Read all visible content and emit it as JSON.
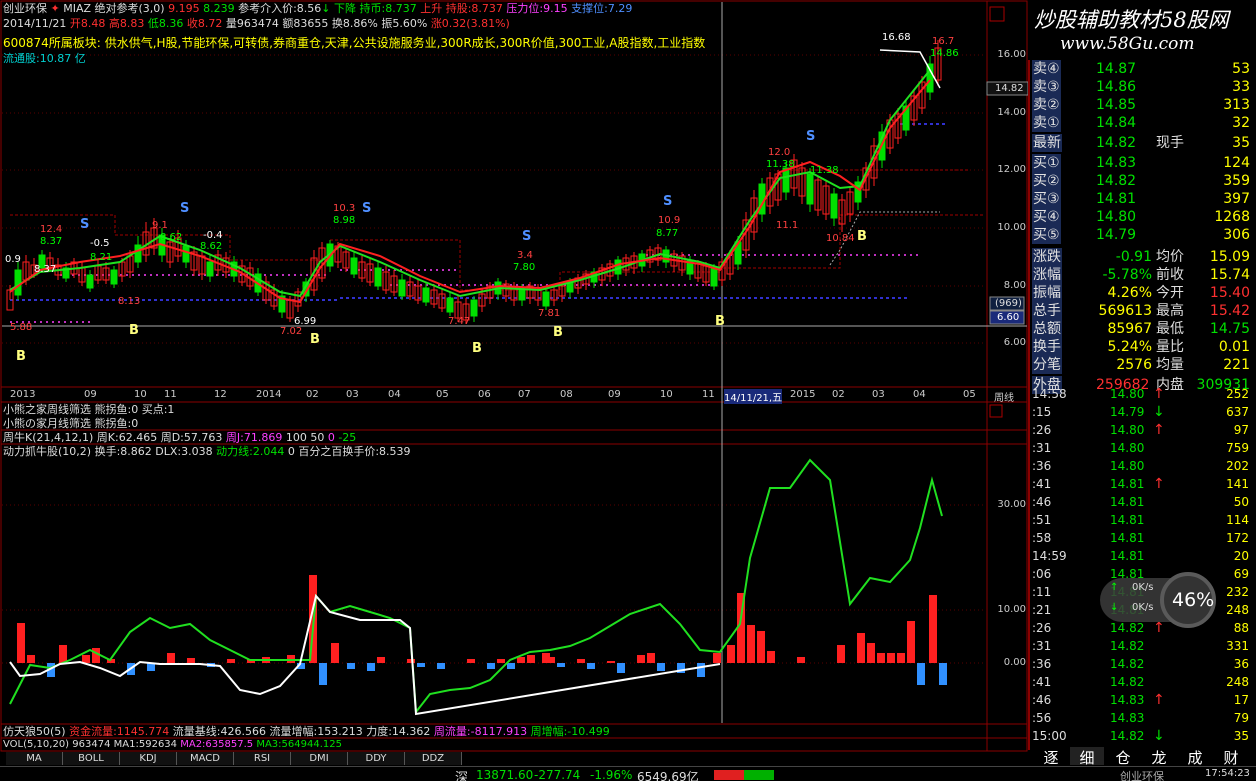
{
  "watermark": {
    "text": "炒股辅助教材58股网",
    "url": "www.58Gu.com"
  },
  "header": {
    "stock": "创业环保",
    "mode": "MIAZ",
    "ref": "绝对参考(3,0)",
    "ref_v1": "9.195",
    "ref_v2": "8.239",
    "ref_in": "参考介入价:8.56",
    "down": "下降",
    "hold": "持币:8.737",
    "up": "上升",
    "hold2": "持股:8.737",
    "press": "压力位:9.15",
    "support": "支撑位:7.29",
    "date": "2014/11/21",
    "open": "开8.48",
    "high": "高8.83",
    "low": "低8.36",
    "close": "收8.72",
    "vol": "量963474",
    "amt": "额83655",
    "turn": "换8.86%",
    "amp": "振5.60%",
    "chg": "涨0.32(3.81%)",
    "sector_label": "600874所属板块:",
    "sectors": "供水供气,H股,节能环保,可转债,券商重仓,天津,公共设施服务业,300R成长,300R价值,300工业,A股指数,工业指数",
    "float": "流通股:10.87 亿"
  },
  "price_axis": [
    "16.00",
    "14.00",
    "12.00",
    "10.00",
    "8.00",
    "6.00"
  ],
  "price_tags": {
    "last": "14.82",
    "crosshair_top": "(969)",
    "crosshair_val": "6.60"
  },
  "time_axis": [
    "2013",
    "09",
    "10",
    "11",
    "12",
    "2014",
    "02",
    "03",
    "04",
    "05",
    "06",
    "07",
    "08",
    "09",
    "10",
    "11",
    "14/11/21,五",
    "2015",
    "02",
    "03",
    "04",
    "05",
    "周线"
  ],
  "annotations": [
    "16.68",
    "16.7",
    "14.86",
    "12.4",
    "8.37",
    "-0.5",
    "8.21",
    "9.1",
    "8.62",
    "-0.4",
    "8.62",
    "10.3",
    "8.98",
    "3.4",
    "7.80",
    "10.9",
    "8.77",
    "12.0",
    "11.38",
    "11.1",
    "11.38",
    "10.84",
    "6.99",
    "7.02",
    "7.47",
    "7.81",
    "8.13",
    "8.37",
    "5.88",
    "0.9"
  ],
  "ind1": {
    "l1": "小熊之家周线筛选 熊拐鱼:0 买点:1",
    "l2": "小熊の家月线筛选 熊拐鱼:0"
  },
  "ind2": {
    "name": "周牛K(21,4,12,1)",
    "k": "周K:62.465",
    "d": "周D:57.763",
    "j": "周J:71.869",
    "v100": "100",
    "v50": "50",
    "v0": "0",
    "vm25": "-25"
  },
  "ind3": {
    "name": "动力抓牛股(10,2)",
    "turn": "换手:8.862",
    "dlx": "DLX:3.038",
    "power": "动力线:2.044",
    "zero": "0",
    "pct": "百分之百换手价:8.539"
  },
  "sub_axis": [
    "30.00",
    "10.00",
    "0.00"
  ],
  "ind4": {
    "name": "仿天狼50(5)",
    "fund": "资金流量:1145.774",
    "base": "流量基线:426.566",
    "inc": "流量增幅:153.213",
    "force": "力度:14.362",
    "week": "周流量:-8117.913",
    "wk_inc": "周增幅:-10.499"
  },
  "vol_line": {
    "name": "VOL(5,10,20)",
    "v": "963474",
    "ma1": "MA1:592634",
    "ma2": "MA2:635857.5",
    "ma3": "MA3:564944.125"
  },
  "tabs": [
    "MA",
    "BOLL",
    "KDJ",
    "MACD",
    "RSI",
    "DMI",
    "DDY",
    "DDZ"
  ],
  "status": {
    "idx": "深",
    "val": "13871.60",
    "chg": "-277.74",
    "pct": "-1.96%",
    "amt": "6549.69亿",
    "name": "创业环保",
    "time": "17:54:23"
  },
  "quote": {
    "asks": [
      {
        "l": "卖④",
        "p": "14.87",
        "v": "53"
      },
      {
        "l": "卖③",
        "p": "14.86",
        "v": "33"
      },
      {
        "l": "卖②",
        "p": "14.85",
        "v": "313"
      },
      {
        "l": "卖①",
        "p": "14.84",
        "v": "32"
      }
    ],
    "last": {
      "l": "最新",
      "p": "14.82",
      "t": "现手",
      "v": "35"
    },
    "bids": [
      {
        "l": "买①",
        "p": "14.83",
        "v": "124"
      },
      {
        "l": "买②",
        "p": "14.82",
        "v": "359"
      },
      {
        "l": "买③",
        "p": "14.81",
        "v": "397"
      },
      {
        "l": "买④",
        "p": "14.80",
        "v": "1268"
      },
      {
        "l": "买⑤",
        "p": "14.79",
        "v": "306"
      }
    ],
    "stats": [
      {
        "l": "涨跌",
        "v": "-0.91",
        "l2": "均价",
        "v2": "15.09"
      },
      {
        "l": "涨幅",
        "v": "-5.78%",
        "l2": "前收",
        "v2": "15.74"
      },
      {
        "l": "振幅",
        "v": "4.26%",
        "l2": "今开",
        "v2": "15.40"
      },
      {
        "l": "总手",
        "v": "569613",
        "l2": "最高",
        "v2": "15.42"
      },
      {
        "l": "总额",
        "v": "85967",
        "l2": "最低",
        "v2": "14.75"
      },
      {
        "l": "换手",
        "v": "5.24%",
        "l2": "量比",
        "v2": "0.01"
      },
      {
        "l": "分笔",
        "v": "2576",
        "l2": "均量",
        "v2": "221"
      }
    ],
    "outer": {
      "l": "外盘",
      "v": "259682",
      "l2": "内盘",
      "v2": "309931"
    }
  },
  "ticks": [
    {
      "t": "14:58",
      "p": "14.80",
      "a": "up",
      "v": "252"
    },
    {
      "t": ":15",
      "p": "14.79",
      "a": "down",
      "v": "637"
    },
    {
      "t": ":26",
      "p": "14.80",
      "a": "up",
      "v": "97"
    },
    {
      "t": ":31",
      "p": "14.80",
      "a": "",
      "v": "759"
    },
    {
      "t": ":36",
      "p": "14.80",
      "a": "",
      "v": "202"
    },
    {
      "t": ":41",
      "p": "14.81",
      "a": "up",
      "v": "141"
    },
    {
      "t": ":46",
      "p": "14.81",
      "a": "",
      "v": "50"
    },
    {
      "t": ":51",
      "p": "14.81",
      "a": "",
      "v": "114"
    },
    {
      "t": ":58",
      "p": "14.81",
      "a": "",
      "v": "172"
    },
    {
      "t": "14:59",
      "p": "14.81",
      "a": "",
      "v": "20"
    },
    {
      "t": ":06",
      "p": "14.81",
      "a": "",
      "v": "69"
    },
    {
      "t": ":11",
      "p": "14.81",
      "a": "",
      "v": "232"
    },
    {
      "t": ":21",
      "p": "14.81",
      "a": "",
      "v": "248"
    },
    {
      "t": ":26",
      "p": "14.82",
      "a": "up",
      "v": "88"
    },
    {
      "t": ":31",
      "p": "14.82",
      "a": "",
      "v": "331"
    },
    {
      "t": ":36",
      "p": "14.82",
      "a": "",
      "v": "36"
    },
    {
      "t": ":41",
      "p": "14.82",
      "a": "",
      "v": "248"
    },
    {
      "t": ":46",
      "p": "14.83",
      "a": "up",
      "v": "17"
    },
    {
      "t": ":56",
      "p": "14.83",
      "a": "",
      "v": "79"
    },
    {
      "t": "15:00",
      "p": "14.82",
      "a": "down",
      "v": "35"
    }
  ],
  "gauge": {
    "pct": "46%",
    "up": "0K/s",
    "down": "0K/s"
  },
  "right_tabs": [
    "逐",
    "细",
    "仓",
    "龙",
    "成",
    "财"
  ],
  "colors": {
    "up": "#ff3030",
    "down": "#00e000",
    "ma": "#ffffff"
  }
}
